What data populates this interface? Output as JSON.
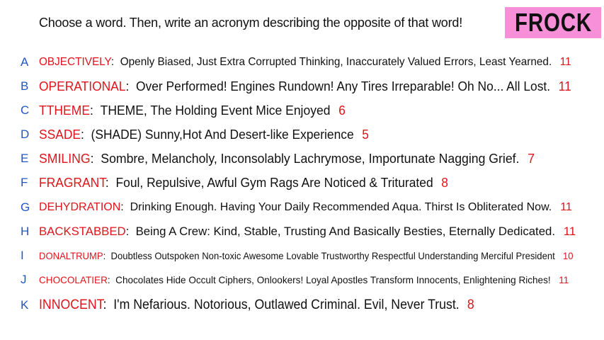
{
  "prompt": "Choose a word. Then, write an acronym describing the opposite of that word!",
  "badge": {
    "text": "FROCK",
    "color": "#f78fd9"
  },
  "colors": {
    "letter": "#1f57c5",
    "word": "#e0141b",
    "count": "#e0141b",
    "text": "#111111"
  },
  "entries": [
    {
      "letter": "A",
      "word": "OBJECTIVELY",
      "sep": ":",
      "acronym": "Openly Biased, Just Extra Corrupted Thinking, Inaccurately Valued Errors, Least Yearned.",
      "count": "11"
    },
    {
      "letter": "B",
      "word": "OPERATIONAL",
      "sep": ":",
      "acronym": "Over Performed! Engines Rundown! Any Tires Irreparable! Oh No... All Lost.",
      "count": "11"
    },
    {
      "letter": "C",
      "word": "TTHEME",
      "sep": ":",
      "acronym": "THEME, The Holding Event Mice Enjoyed",
      "count": "6"
    },
    {
      "letter": "D",
      "word": "SSADE",
      "sep": ":",
      "acronym": "(SHADE) Sunny,Hot And Desert-like Experience",
      "count": "5"
    },
    {
      "letter": "E",
      "word": "SMILING",
      "sep": ":",
      "acronym": "Sombre, Melancholy, Inconsolably Lachrymose, Importunate Nagging Grief.",
      "count": "7"
    },
    {
      "letter": "F",
      "word": "FRAGRANT",
      "sep": ":",
      "acronym": "Foul, Repulsive, Awful Gym Rags Are Noticed & Triturated",
      "count": "8"
    },
    {
      "letter": "G",
      "word": "DEHYDRATION",
      "sep": ":",
      "acronym": "Drinking Enough. Having Your Daily Recommended Aqua. Thirst Is Obliterated Now.",
      "count": "11"
    },
    {
      "letter": "H",
      "word": "BACKSTABBED",
      "sep": ":",
      "acronym": "Being A Crew: Kind, Stable, Trusting And Basically Besties, Eternally Dedicated.",
      "count": "11"
    },
    {
      "letter": "I",
      "word": "DONALTRUMP",
      "sep": ":",
      "acronym": "Doubtless Outspoken Non-toxic Awesome Lovable Trustworthy Respectful Understanding Merciful President",
      "count": "10"
    },
    {
      "letter": "J",
      "word": "CHOCOLATIER",
      "sep": ":",
      "acronym": "Chocolates Hide Occult Ciphers, Onlookers! Loyal Apostles Transform Innocents, Enlightening Riches!",
      "count": "11"
    },
    {
      "letter": "K",
      "word": "INNOCENT",
      "sep": ":",
      "acronym": "I'm Nefarious. Notorious, Outlawed Criminal. Evil, Never Trust.",
      "count": "8"
    }
  ]
}
